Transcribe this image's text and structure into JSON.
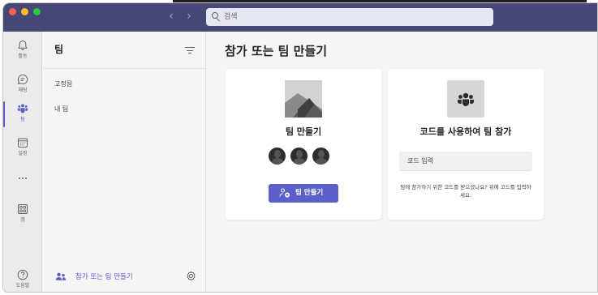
{
  "search": {
    "placeholder": "검색"
  },
  "rail": {
    "items": [
      {
        "label": "활동",
        "icon": "bell-icon"
      },
      {
        "label": "채팅",
        "icon": "chat-icon"
      },
      {
        "label": "팀",
        "icon": "teams-icon",
        "active": true
      },
      {
        "label": "일정",
        "icon": "calendar-icon"
      },
      {
        "label": "",
        "icon": "more-icon"
      },
      {
        "label": "앱",
        "icon": "apps-icon"
      },
      {
        "label": "도움말",
        "icon": "help-icon"
      }
    ]
  },
  "panel": {
    "title": "팀",
    "sections": {
      "pinned": "고정됨",
      "my_teams": "내 팀"
    },
    "footer_label": "참가 또는 팀 만들기"
  },
  "main": {
    "title": "참가 또는 팀 만들기",
    "create_card": {
      "title": "팀 만들기",
      "button_label": "팀 만들기"
    },
    "join_card": {
      "title": "코드를 사용하여 팀 참가",
      "input_placeholder": "코드 입력",
      "help_text": "팀에 참가하기 위한 코드를 받으셨나요? 위에 코드를 입력하세요."
    }
  },
  "colors": {
    "title_bar": "#464775",
    "accent": "#5b5fc7"
  }
}
